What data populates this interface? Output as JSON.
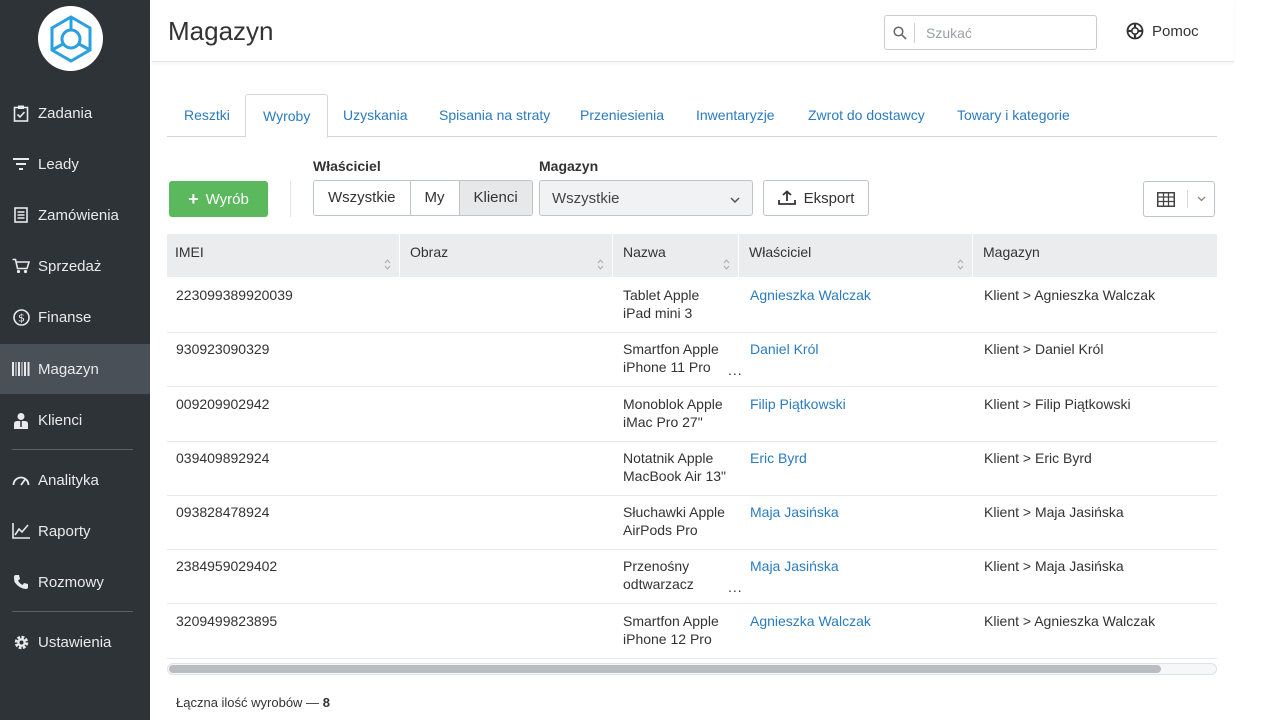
{
  "sidebar": {
    "items": [
      {
        "label": "Zadania",
        "icon": "clipboard-icon"
      },
      {
        "label": "Leady",
        "icon": "filter-icon"
      },
      {
        "label": "Zamówienia",
        "icon": "orders-icon"
      },
      {
        "label": "Sprzedaż",
        "icon": "cart-icon"
      },
      {
        "label": "Finanse",
        "icon": "dollar-icon"
      },
      {
        "label": "Magazyn",
        "icon": "barcode-icon"
      },
      {
        "label": "Klienci",
        "icon": "client-icon"
      },
      {
        "label": "Analityka",
        "icon": "gauge-icon"
      },
      {
        "label": "Raporty",
        "icon": "chart-icon"
      },
      {
        "label": "Rozmowy",
        "icon": "phone-icon"
      },
      {
        "label": "Ustawienia",
        "icon": "gear-icon"
      }
    ]
  },
  "header": {
    "title": "Magazyn",
    "search_placeholder": "Szukać",
    "help_label": "Pomoc"
  },
  "tabs": [
    "Resztki",
    "Wyroby",
    "Uzyskania",
    "Spisania na straty",
    "Przeniesienia",
    "Inwentaryzje",
    "Zwrot do dostawcy",
    "Towary i kategorie"
  ],
  "toolbar": {
    "add_label": "Wyrób",
    "owner_label": "Właściciel",
    "owner_options": [
      "Wszystkie",
      "My",
      "Klienci"
    ],
    "warehouse_label": "Magazyn",
    "warehouse_value": "Wszystkie",
    "export_label": "Eksport"
  },
  "table": {
    "columns": [
      "IMEI",
      "Obraz",
      "Nazwa",
      "Właściciel",
      "Magazyn"
    ],
    "rows": [
      {
        "imei": "223099389920039",
        "name1": "Tablet Apple",
        "name2": "iPad mini 3",
        "owner": "Agnieszka Walczak",
        "warehouse": "Klient > Agnieszka Walczak",
        "ellipsis": ""
      },
      {
        "imei": "930923090329",
        "name1": "Smartfon Apple",
        "name2": "iPhone 11 Pro",
        "owner": "Daniel Król",
        "warehouse": "Klient > Daniel Król",
        "ellipsis": "..."
      },
      {
        "imei": "009209902942",
        "name1": "Monoblok Apple",
        "name2": "iMac Pro 27\"",
        "owner": "Filip Piątkowski",
        "warehouse": "Klient > Filip Piątkowski",
        "ellipsis": ""
      },
      {
        "imei": "039409892924",
        "name1": "Notatnik Apple",
        "name2": "MacBook Air 13\"",
        "owner": "Eric Byrd",
        "warehouse": "Klient > Eric Byrd",
        "ellipsis": ""
      },
      {
        "imei": "093828478924",
        "name1": "Słuchawki Apple",
        "name2": "AirPods Pro",
        "owner": "Maja Jasińska",
        "warehouse": "Klient > Maja Jasińska",
        "ellipsis": ""
      },
      {
        "imei": "2384959029402",
        "name1": "Przenośny",
        "name2": "odtwarzacz",
        "owner": "Maja Jasińska",
        "warehouse": "Klient > Maja Jasińska",
        "ellipsis": "..."
      },
      {
        "imei": "3209499823895",
        "name1": "Smartfon Apple",
        "name2": "iPhone 12 Pro",
        "owner": "Agnieszka Walczak",
        "warehouse": "Klient > Agnieszka Walczak",
        "ellipsis": ""
      }
    ]
  },
  "footer": {
    "label": "Łączna ilość wyrobów —",
    "count": "8"
  },
  "colors": {
    "sidebar_bg": "#2e3338",
    "sidebar_active": "#4a5057",
    "accent": "#2a7bc0",
    "add_button": "#5cb85c",
    "logo_blue": "#2aa0e0"
  }
}
